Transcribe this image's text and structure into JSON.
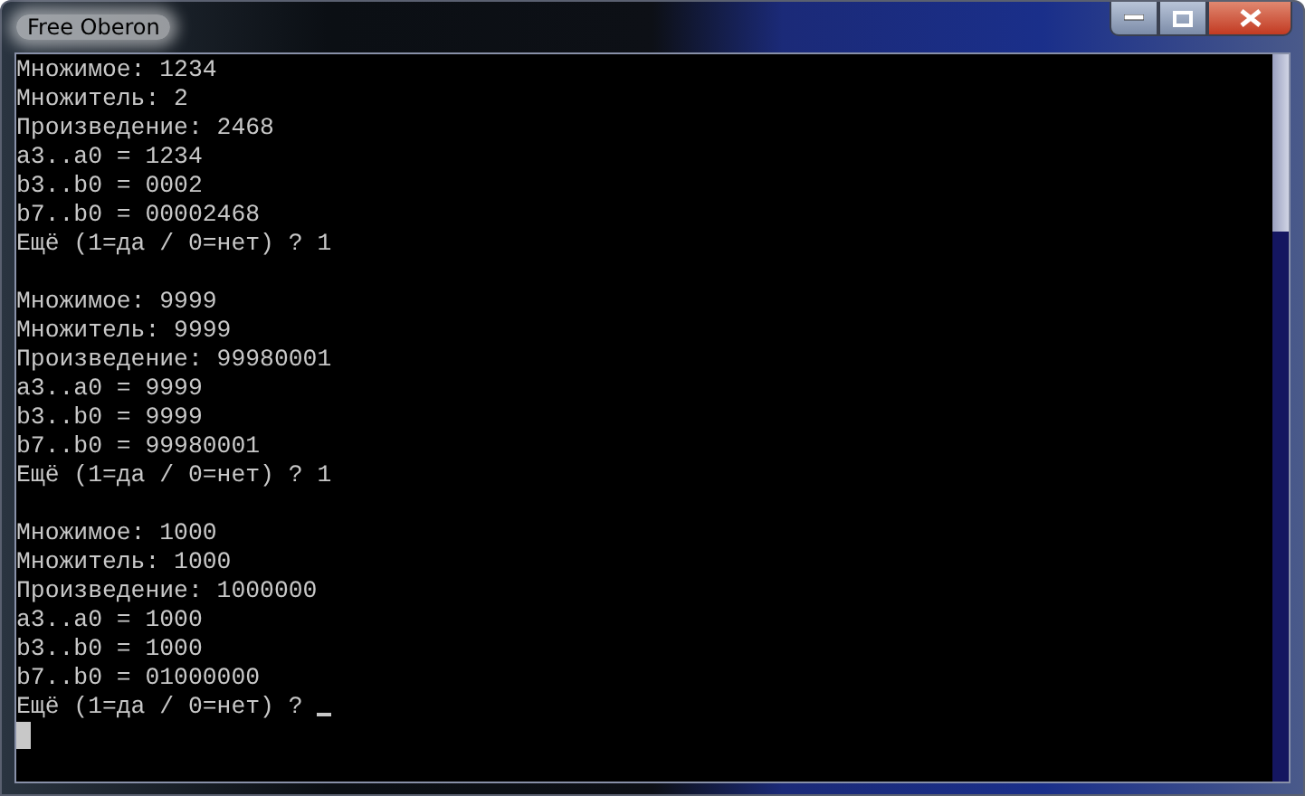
{
  "window": {
    "title": "Free Oberon"
  },
  "console": {
    "blocks": [
      [
        "Множимое: 1234",
        "Множитель: 2",
        "Произведение: 2468",
        "a3..a0 = 1234",
        "b3..b0 = 0002",
        "b7..b0 = 00002468",
        "Ещё (1=да / 0=нет) ? 1"
      ],
      [
        "Множимое: 9999",
        "Множитель: 9999",
        "Произведение: 99980001",
        "a3..a0 = 9999",
        "b3..b0 = 9999",
        "b7..b0 = 99980001",
        "Ещё (1=да / 0=нет) ? 1"
      ],
      [
        "Множимое: 1000",
        "Множитель: 1000",
        "Произведение: 1000000",
        "a3..a0 = 1000",
        "b3..b0 = 1000",
        "b7..b0 = 01000000",
        "Ещё (1=да / 0=нет) ?"
      ]
    ]
  }
}
